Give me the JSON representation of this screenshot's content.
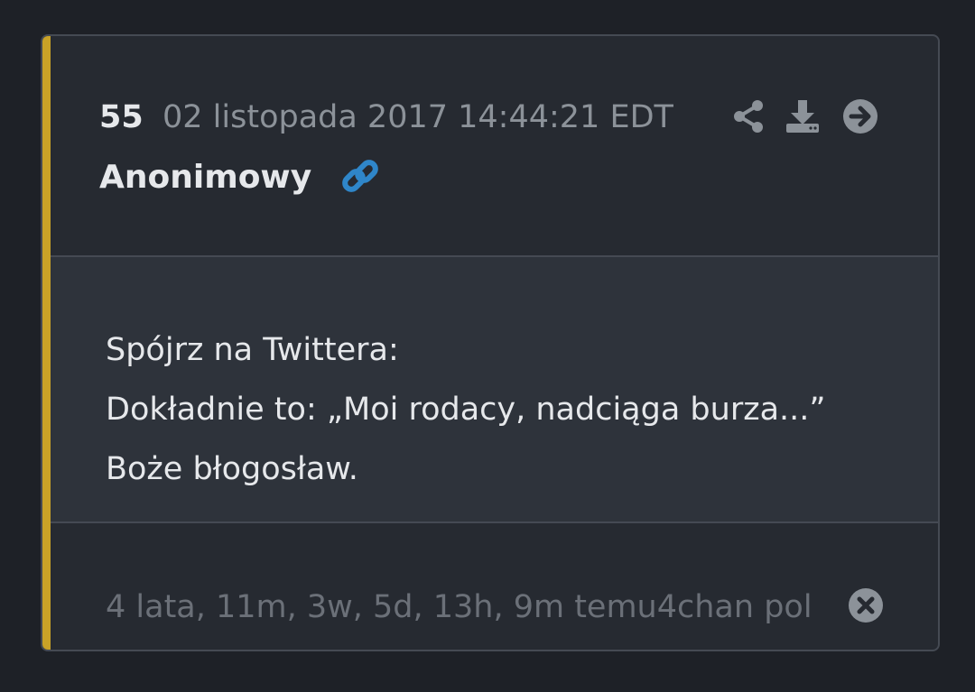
{
  "post": {
    "number": "55",
    "date": "02 listopada 2017 14:44:21 EDT",
    "author": "Anonimowy",
    "message_lines": [
      "Spójrz na Twittera:",
      "Dokładnie to: „Moi rodacy, nadciąga burza...”",
      "Boże błogosław."
    ],
    "relative_time_and_source": "4 lata, 11m, 3w, 5d, 13h, 9m temu4chan pol"
  },
  "icons": {
    "link": "link-icon",
    "share": "share-icon",
    "download": "download-icon",
    "forward": "arrow-right-circle-icon",
    "close": "close-circle-icon"
  },
  "colors": {
    "accent": "#c9a227",
    "link": "#2f86c9",
    "background": "#1e2127",
    "card": "#262a31",
    "message_area": "#2e333b"
  }
}
